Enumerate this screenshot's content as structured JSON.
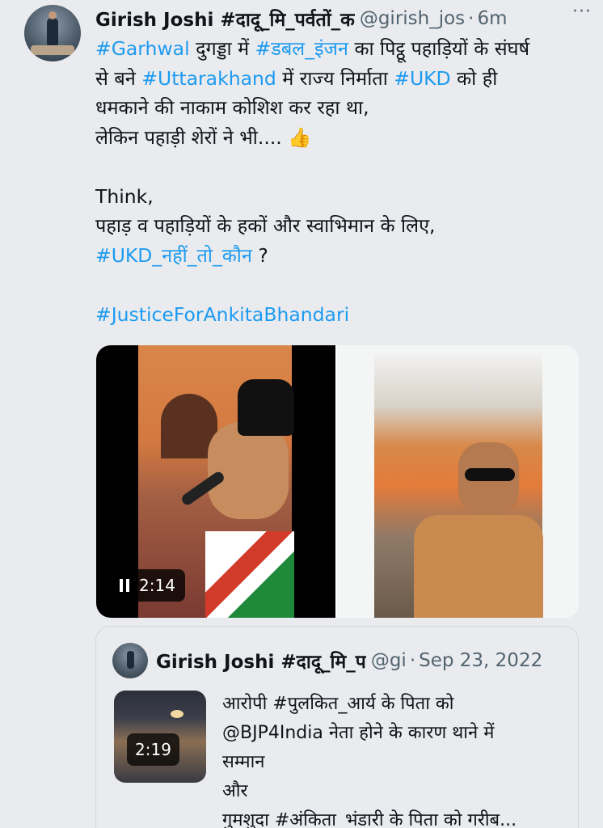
{
  "tweet": {
    "author_name": "Girish Joshi #दादू_मि_पर्वतों_क",
    "handle": "@girish_jos",
    "separator": "·",
    "time": "6m",
    "more_icon": "more-dots-icon",
    "lines": [
      [
        {
          "t": "#Garhwal",
          "tag": true
        },
        {
          "t": " दुगड्डा में ",
          "tag": false
        },
        {
          "t": "#डबल_इंजन",
          "tag": true
        },
        {
          "t": " का पिट्ठू पहाड़ियों के संघर्ष",
          "tag": false
        }
      ],
      [
        {
          "t": "से बने ",
          "tag": false
        },
        {
          "t": "#Uttarakhand",
          "tag": true
        },
        {
          "t": " में राज्य निर्माता ",
          "tag": false
        },
        {
          "t": "#UKD",
          "tag": true
        },
        {
          "t": " को ही",
          "tag": false
        }
      ],
      [
        {
          "t": "धमकाने की नाकाम कोशिश कर रहा था,",
          "tag": false
        }
      ],
      [
        {
          "t": "लेकिन पहाड़ी शेरों ने भी.... 👍",
          "tag": false
        }
      ],
      [],
      [
        {
          "t": "Think,",
          "tag": false
        }
      ],
      [
        {
          "t": "पहाड़ व पहाड़ियों के हकों और स्वाभिमान के लिए,",
          "tag": false
        }
      ],
      [
        {
          "t": "#UKD_नहीं_तो_कौन",
          "tag": true
        },
        {
          "t": " ?",
          "tag": false
        }
      ],
      [],
      [
        {
          "t": "#JusticeForAnkitaBhandari",
          "tag": true
        }
      ]
    ],
    "media": {
      "video_duration": "2:14",
      "pause_icon": "pause-icon"
    }
  },
  "quoted_tweet": {
    "author_name": "Girish Joshi #दादू_मि_प",
    "handle": "@gi",
    "separator": "·",
    "time": "Sep 23, 2022",
    "video_duration": "2:19",
    "lines": [
      "आरोपी #पुलकित_आर्य के पिता को",
      "@BJP4India नेता होने के कारण थाने में",
      "सम्मान",
      "और",
      "गुमशुदा #अंकिता_भंडारी के पिता को गरीब..."
    ]
  },
  "colors": {
    "link": "#1d9bf0",
    "text": "#0f1419",
    "muted": "#536471",
    "background": "#e9ebee",
    "border": "#cfd9de"
  }
}
